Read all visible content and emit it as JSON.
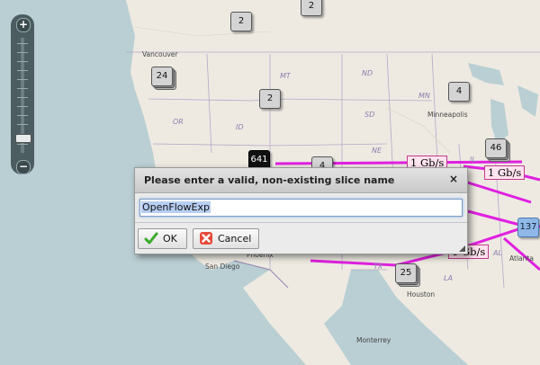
{
  "map": {
    "state_labels": [
      "MT",
      "ND",
      "MN",
      "OR",
      "ID",
      "SD",
      "NE",
      "IL",
      "AL",
      "LA",
      "TX"
    ],
    "city_labels": [
      "Vancouver",
      "Minneapolis",
      "Phoenix",
      "San Diego",
      "Houston",
      "Atlanta",
      "Monterrey"
    ],
    "clusters": [
      "2",
      "2",
      "24",
      "2",
      "4",
      "46",
      "641",
      "4",
      "25",
      "137"
    ],
    "bandwidth_labels": [
      "1 Gb/s",
      "1 Gb/s",
      "1 Gb/s"
    ],
    "link_color": "#e020e0"
  },
  "zoom": {
    "zoom_in": "+",
    "zoom_out": "−"
  },
  "dialog": {
    "title": "Please enter a valid, non-existing slice name",
    "close": "×",
    "input_value": "OpenFlowExp",
    "ok_label": "OK",
    "cancel_label": "Cancel"
  }
}
